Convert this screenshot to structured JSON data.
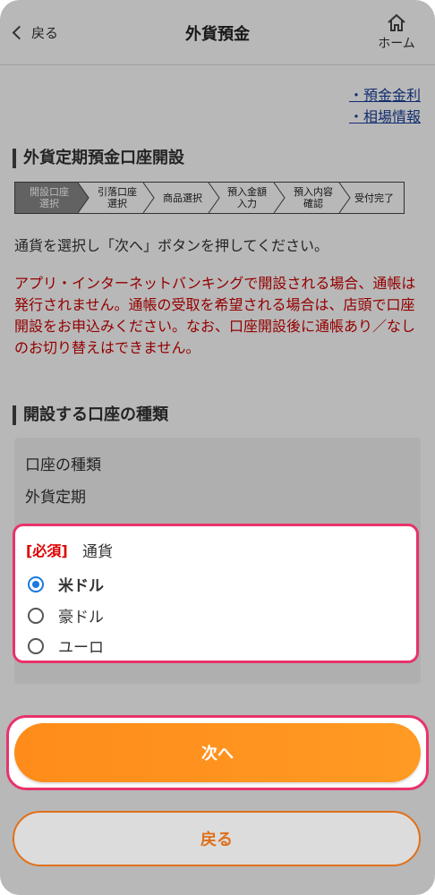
{
  "header": {
    "back_label": "戻る",
    "title": "外貨預金",
    "home_label": "ホーム"
  },
  "links": [
    "・預金金利",
    "・相場情報"
  ],
  "section1_title": "外貨定期預金口座開設",
  "steps": [
    {
      "line1": "開設口座",
      "line2": "選択",
      "active": true
    },
    {
      "line1": "引落口座",
      "line2": "選択",
      "active": false
    },
    {
      "line1": "商品選択",
      "line2": "",
      "active": false
    },
    {
      "line1": "預入金額",
      "line2": "入力",
      "active": false
    },
    {
      "line1": "預入内容",
      "line2": "確認",
      "active": false
    },
    {
      "line1": "受付完了",
      "line2": "",
      "active": false
    }
  ],
  "instruction": "通貨を選択し「次へ」ボタンを押してください。",
  "notice": "アプリ・インターネットバンキングで開設される場合、通帳は発行されません。通帳の受取を希望される場合は、店頭で口座開設をお申込みください。なお、口座開設後に通帳あり／なしのお切り替えはできません。",
  "section2_title": "開設する口座の種類",
  "account_type": {
    "label": "口座の種類",
    "value": "外貨定期"
  },
  "currency": {
    "required": "[必須]",
    "label": "通貨",
    "options": [
      {
        "label": "米ドル",
        "selected": true
      },
      {
        "label": "豪ドル",
        "selected": false
      },
      {
        "label": "ユーロ",
        "selected": false
      }
    ]
  },
  "buttons": {
    "next": "次へ",
    "back": "戻る"
  },
  "colors": {
    "accent": "#ff8c1a",
    "highlight": "#e8336a",
    "link": "#1a3f9a",
    "notice": "#cc0000",
    "radio": "#1a7ae0"
  }
}
